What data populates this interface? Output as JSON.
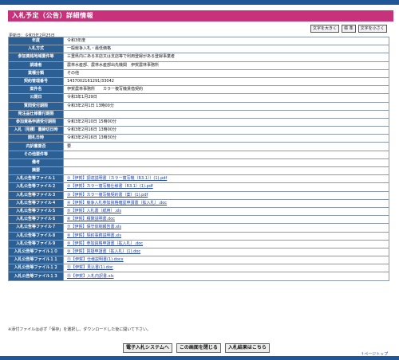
{
  "header": {
    "title": "入札予定（公告）詳細情報"
  },
  "font_size": {
    "large": "文字を大きく",
    "standard": "標 準",
    "small": "文字を小さく"
  },
  "updated": "更新日：令和3年2月25日",
  "rows": [
    {
      "label": "年度",
      "value": "令和3年度"
    },
    {
      "label": "入札方式",
      "value": "一般競争入札・最低価格"
    },
    {
      "label": "参加資格地域要件等",
      "value": "三重県内にある本店又は支店等で利用登録がある登録事業者"
    },
    {
      "label": "調達者",
      "value": "農林水産部、農林水産部出先機関　伊賀農林事務所"
    },
    {
      "label": "業種分類",
      "value": "その他"
    },
    {
      "label": "契約管理番号",
      "value": "1437002161291/33042"
    },
    {
      "label": "案件名",
      "value": "伊賀農林事務所　　カラー複写機賃借契約"
    },
    {
      "label": "公開日",
      "value": "令和3年1月29日"
    },
    {
      "label": "質問受付期限",
      "value": "令和3年2月1日 13時00分"
    },
    {
      "label": "発注品仕様書付期限",
      "value": ""
    },
    {
      "label": "参加資格申請受付期限",
      "value": "令和3年2月10日 15時00分"
    },
    {
      "label": "入札（見積）書締切日時",
      "value": "令和3年2月16日 13時00分"
    },
    {
      "label": "開札日時",
      "value": "令和3年2月16日 13時30分"
    },
    {
      "label": "内訳書要否",
      "value": "要"
    },
    {
      "label": "その他要件等",
      "value": ""
    },
    {
      "label": "備考",
      "value": ""
    },
    {
      "label": "摘要",
      "value": ""
    }
  ],
  "files": [
    {
      "label": "入札公告等ファイル１",
      "value": "①【伊賀】調達説明書（カラー複写機（R3.1））(1).pdf"
    },
    {
      "label": "入札公告等ファイル２",
      "value": "②【伊賀】カラー複写機仕様書（R3.1）(1).pdf"
    },
    {
      "label": "入札公告等ファイル３",
      "value": "③【伊賀】カラー複写機契約書（案）(1).pdf"
    },
    {
      "label": "入札公告等ファイル４",
      "value": "④【伊賀】競争入札参加資格確認申請書（拡入札）.doc"
    },
    {
      "label": "入札公告等ファイル５",
      "value": "⑤【伊賀】入札書（紙用）.xls"
    },
    {
      "label": "入札公告等ファイル６",
      "value": "⑥【伊賀】積算説明書.doc"
    },
    {
      "label": "入札公告等ファイル７",
      "value": "⑦【伊賀】保守体制報告書.xls"
    },
    {
      "label": "入札公告等ファイル８",
      "value": "⑧【伊賀】契約事務説明書.xls"
    },
    {
      "label": "入札公告等ファイル９",
      "value": "⑨【伊賀】参加資格申請書（拡入札）.doc"
    },
    {
      "label": "入札公告等ファイル１０",
      "value": "⑩【伊賀】質疑申請書（拡入札）(1).doc"
    },
    {
      "label": "入札公告等ファイル１１",
      "value": "⑪【伊賀】仕様説明書(1).docx"
    },
    {
      "label": "入札公告等ファイル１２",
      "value": "⑫【伊賀】見込書(1).doc"
    },
    {
      "label": "入札公告等ファイル１３",
      "value": "⑬【伊賀】入札内訳書.xls"
    }
  ],
  "note": "※添付ファイルは必ず「保存」を選択し、ダウンロードした後に開いて下さい。",
  "buttons": {
    "system": "電子入札システムへ",
    "close": "この画面を閉じる",
    "results": "入札結果はこちら"
  },
  "pagetop": "↑ページトップ"
}
